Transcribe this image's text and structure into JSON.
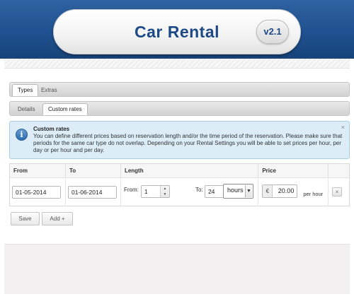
{
  "header": {
    "title": "Car Rental",
    "version": "v2.1"
  },
  "tabs_main": [
    {
      "label": "Types",
      "active": true
    },
    {
      "label": "Extras",
      "active": false
    }
  ],
  "tabs_sub": [
    {
      "label": "Details",
      "active": false
    },
    {
      "label": "Custom rates",
      "active": true
    }
  ],
  "info": {
    "title": "Custom rates",
    "text": "You can define different prices based on reservation length and/or the time period of the reservation. Please make sure that periods for the same car type do not overlap. Depending on your Rental Settings you will be able to set prices per hour, per day or per hour and per day.",
    "close_icon": "×"
  },
  "table": {
    "headers": {
      "from": "From",
      "to": "To",
      "length": "Length",
      "price": "Price"
    },
    "row": {
      "from_date": "01-05-2014",
      "to_date": "01-06-2014",
      "length_from_label": "From:",
      "length_from_value": "1",
      "length_to_label": "To:",
      "length_to_value": "24",
      "unit": "hours",
      "currency": "€",
      "price": "20.00",
      "price_suffix": "per hour",
      "remove_icon": "×"
    }
  },
  "buttons": {
    "save": "Save",
    "add": "Add +"
  },
  "colors": {
    "header_blue": "#1e4f8e",
    "title_blue": "#1d4a86",
    "info_bg": "#dcedf8"
  }
}
